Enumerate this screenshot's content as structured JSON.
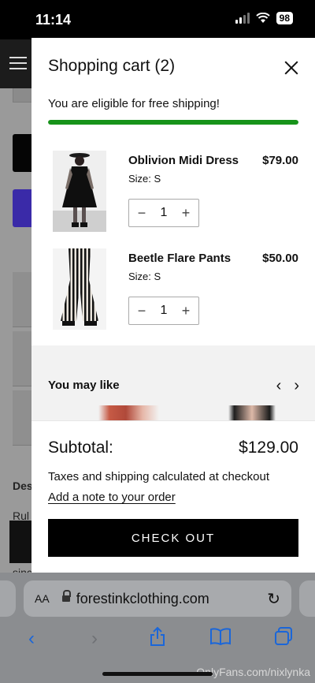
{
  "status_bar": {
    "time": "11:14",
    "battery": "98"
  },
  "background_page": {
    "section_label": "Des",
    "text_fragment": "Rul",
    "text_fragment2": "sinc"
  },
  "cart": {
    "title": "Shopping cart (2)",
    "shipping_message": "You are eligible for free shipping!",
    "shipping_progress_percent": 100,
    "items": [
      {
        "name": "Oblivion Midi Dress",
        "price": "$79.00",
        "size": "Size: S",
        "quantity": "1",
        "minus": "−",
        "plus": "+"
      },
      {
        "name": "Beetle Flare Pants",
        "price": "$50.00",
        "size": "Size: S",
        "quantity": "1",
        "minus": "−",
        "plus": "+"
      }
    ],
    "suggestions": {
      "title": "You may like",
      "prev": "‹",
      "next": "›"
    },
    "subtotal_label": "Subtotal:",
    "subtotal_value": "$129.00",
    "taxes_note": "Taxes and shipping calculated at checkout",
    "add_note_link": "Add a note to your order",
    "checkout_label": "CHECK OUT"
  },
  "browser": {
    "text_size_button": "AA",
    "url": "forestinkclothing.com",
    "reload_icon": "↻",
    "back_icon": "‹",
    "forward_icon": "›"
  },
  "watermark": "OnlyFans.com/nixlynka",
  "colors": {
    "progress": "#17931a",
    "checkout_bg": "#000000",
    "safari_blue": "#1a66d9"
  }
}
